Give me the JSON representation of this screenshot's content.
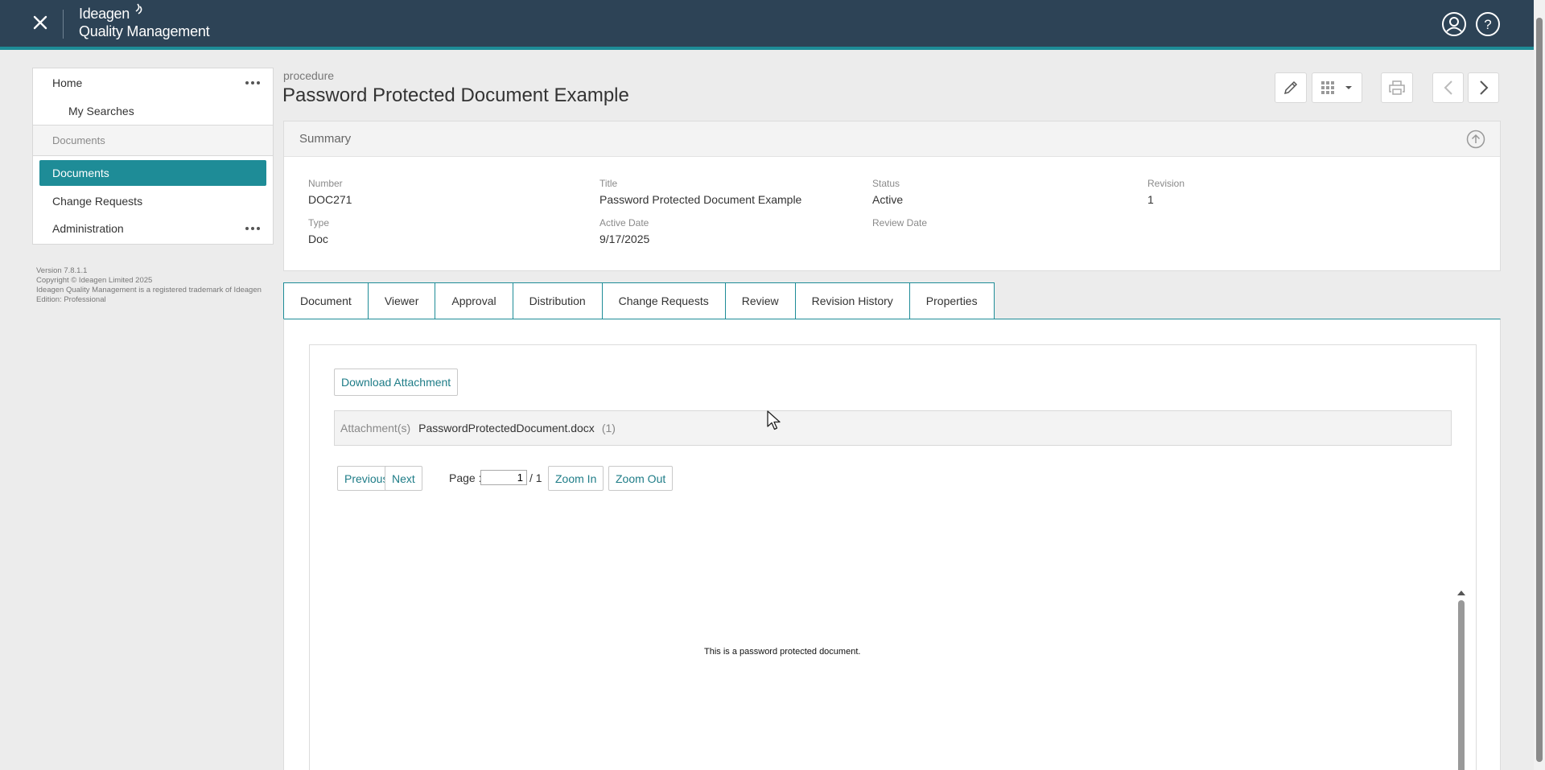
{
  "app": {
    "brand_top": "Ideagen",
    "brand_bottom": "Quality Management"
  },
  "sidebar": {
    "home": "Home",
    "my_searches": "My Searches",
    "section": "Documents",
    "active_item": "Documents",
    "change_requests": "Change Requests",
    "administration": "Administration"
  },
  "footer": {
    "version": "Version 7.8.1.1",
    "copyright": "Copyright © Ideagen Limited 2025",
    "trademark": "Ideagen Quality Management is a registered trademark of Ideagen",
    "edition": "Edition: Professional"
  },
  "header": {
    "kind": "procedure",
    "title": "Password Protected Document Example"
  },
  "summary": {
    "heading": "Summary",
    "number_label": "Number",
    "number": "DOC271",
    "title_label": "Title",
    "title": "Password Protected Document Example",
    "status_label": "Status",
    "status": "Active",
    "revision_label": "Revision",
    "revision": "1",
    "type_label": "Type",
    "type": "Doc",
    "active_date_label": "Active Date",
    "active_date": "9/17/2025",
    "review_date_label": "Review Date"
  },
  "tabs": [
    "Document",
    "Viewer",
    "Approval",
    "Distribution",
    "Change Requests",
    "Review",
    "Revision History",
    "Properties"
  ],
  "active_tab": "Viewer",
  "viewer": {
    "download_label": "Download Attachment",
    "attachments_label": "Attachment(s)",
    "attachment_file": "PasswordProtectedDocument.docx",
    "attachment_count": "(1)",
    "previous": "Previous",
    "next": "Next",
    "page_label": "Page :",
    "page_value": "1",
    "page_total": "/ 1",
    "zoom_in": "Zoom In",
    "zoom_out": "Zoom Out",
    "document_text": "This is a password protected document."
  },
  "colors": {
    "topbar": "#2d4356",
    "accent": "#1e8c97"
  }
}
